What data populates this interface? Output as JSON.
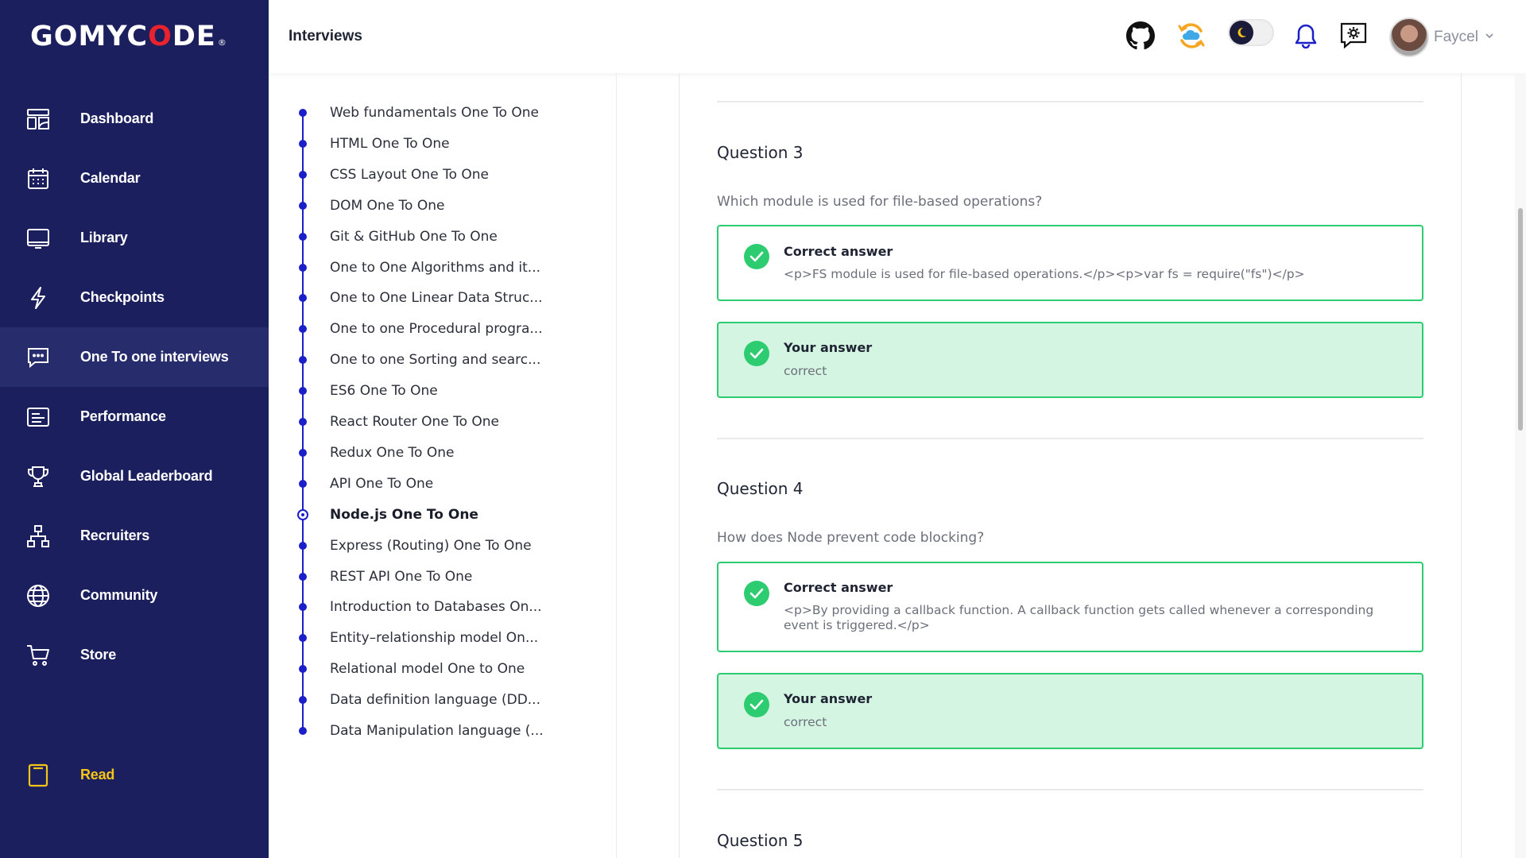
{
  "brand": {
    "logo_prefix": "GOMYC",
    "logo_o": "O",
    "logo_suffix": "DE",
    "logo_mark": "®"
  },
  "sidebar": {
    "items": [
      {
        "label": "Dashboard",
        "icon": "dashboard-icon"
      },
      {
        "label": "Calendar",
        "icon": "calendar-icon"
      },
      {
        "label": "Library",
        "icon": "library-icon"
      },
      {
        "label": "Checkpoints",
        "icon": "lightning-icon"
      },
      {
        "label": "One To one interviews",
        "icon": "chat-icon",
        "active": true
      },
      {
        "label": "Performance",
        "icon": "performance-icon"
      },
      {
        "label": "Global Leaderboard",
        "icon": "trophy-icon"
      },
      {
        "label": "Recruiters",
        "icon": "hierarchy-icon"
      },
      {
        "label": "Community",
        "icon": "globe-icon"
      },
      {
        "label": "Store",
        "icon": "cart-icon"
      }
    ],
    "read": {
      "label": "Read",
      "icon": "book-icon",
      "color": "#f5c518"
    }
  },
  "header": {
    "title": "Interviews",
    "icons": [
      "github-icon",
      "cloud-sync-icon",
      "dark-mode-toggle",
      "bell-icon",
      "settings-chat-icon"
    ],
    "user": {
      "name": "Faycel"
    }
  },
  "timeline": {
    "items": [
      "Web fundamentals One To One",
      "HTML One To One",
      "CSS Layout One To One",
      "DOM One To One",
      "Git & GitHub One To One",
      "One to One Algorithms and it...",
      "One to One Linear Data Struc...",
      "One to one Procedural progra...",
      "One to one Sorting and searc...",
      "ES6 One To One",
      "React Router One To One",
      "Redux One To One",
      "API One To One",
      "Node.js One To One",
      "Express (Routing) One To One",
      "REST API One To One",
      "Introduction to Databases On...",
      "Entity–relationship model On...",
      "Relational model One to One",
      "Data definition language (DD...",
      "Data Manipulation language (..."
    ],
    "active_index": 13
  },
  "questions": [
    {
      "title": "Question 3",
      "text": "Which module is used for file-based operations?",
      "correct_label": "Correct answer",
      "correct": "<p>FS module is used for file-based operations.</p><p>var fs = require(\"fs\")</p>",
      "your_label": "Your answer",
      "your": "correct"
    },
    {
      "title": "Question 4",
      "text": "How does Node prevent code blocking?",
      "correct_label": "Correct answer",
      "correct": "<p>By providing a callback function. A callback function gets called whenever a corresponding event is triggered.</p>",
      "your_label": "Your answer",
      "your": "correct"
    },
    {
      "title": "Question 5"
    }
  ],
  "colors": {
    "sidebar_bg": "#1b1f5e",
    "accent_blue": "#1b1fc8",
    "success_green": "#2ecc71",
    "success_bg": "#d5f5e3",
    "brand_red": "#e8232d"
  }
}
